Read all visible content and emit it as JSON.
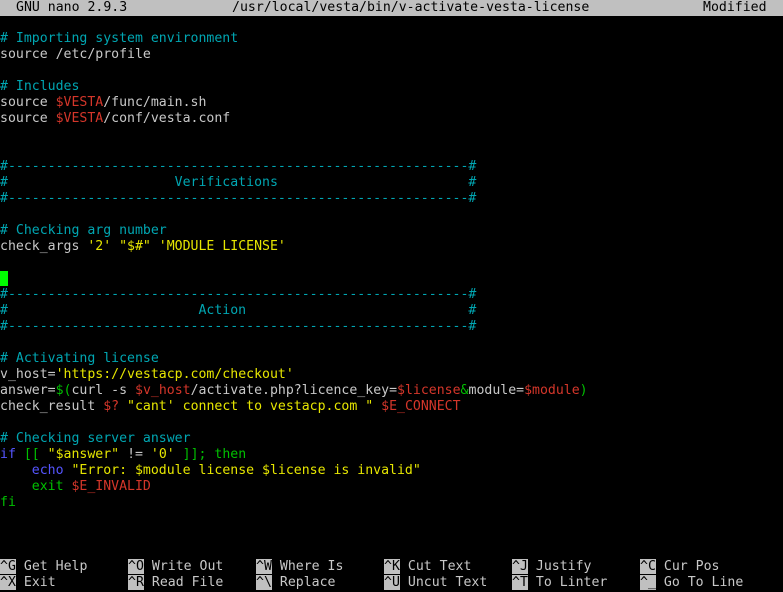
{
  "titlebar": {
    "app": "GNU nano 2.9.3",
    "file": "/usr/local/vesta/bin/v-activate-vesta-license",
    "status": "Modified"
  },
  "code_lines": [
    [
      {
        "t": "# Importing system environment",
        "c": "comment"
      }
    ],
    [
      {
        "t": "source /etc/profile",
        "c": "plain"
      }
    ],
    [],
    [
      {
        "t": "# Includes",
        "c": "comment"
      }
    ],
    [
      {
        "t": "source ",
        "c": "plain"
      },
      {
        "t": "$VESTA",
        "c": "var"
      },
      {
        "t": "/func/main.sh",
        "c": "plain"
      }
    ],
    [
      {
        "t": "source ",
        "c": "plain"
      },
      {
        "t": "$VESTA",
        "c": "var"
      },
      {
        "t": "/conf/vesta.conf",
        "c": "plain"
      }
    ],
    [],
    [],
    [
      {
        "t": "#----------------------------------------------------------#",
        "c": "comment"
      }
    ],
    [
      {
        "t": "#                     Verifications                        #",
        "c": "comment"
      }
    ],
    [
      {
        "t": "#----------------------------------------------------------#",
        "c": "comment"
      }
    ],
    [],
    [
      {
        "t": "# Checking arg number",
        "c": "comment"
      }
    ],
    [
      {
        "t": "check_args ",
        "c": "plain"
      },
      {
        "t": "'2' \"$#\" 'MODULE LICENSE'",
        "c": "str"
      }
    ],
    [],
    [
      {
        "t": "",
        "c": "cursor"
      }
    ],
    [
      {
        "t": "#----------------------------------------------------------#",
        "c": "comment"
      }
    ],
    [
      {
        "t": "#                        Action                            #",
        "c": "comment"
      }
    ],
    [
      {
        "t": "#----------------------------------------------------------#",
        "c": "comment"
      }
    ],
    [],
    [
      {
        "t": "# Activating license",
        "c": "comment"
      }
    ],
    [
      {
        "t": "v_host=",
        "c": "plain"
      },
      {
        "t": "'https://vestacp.com/checkout'",
        "c": "str"
      }
    ],
    [
      {
        "t": "answer=",
        "c": "plain"
      },
      {
        "t": "$(",
        "c": "green"
      },
      {
        "t": "curl -s ",
        "c": "plain"
      },
      {
        "t": "$v_host",
        "c": "var"
      },
      {
        "t": "/activate.php?licence_key=",
        "c": "plain"
      },
      {
        "t": "$license",
        "c": "var"
      },
      {
        "t": "&",
        "c": "green"
      },
      {
        "t": "module=",
        "c": "plain"
      },
      {
        "t": "$module",
        "c": "var"
      },
      {
        "t": ")",
        "c": "green"
      }
    ],
    [
      {
        "t": "check_result ",
        "c": "plain"
      },
      {
        "t": "$?",
        "c": "var"
      },
      {
        "t": " \"cant' connect to vestacp.com \" ",
        "c": "str"
      },
      {
        "t": "$E_CONNECT",
        "c": "var"
      }
    ],
    [],
    [
      {
        "t": "# Checking server answer",
        "c": "comment"
      }
    ],
    [
      {
        "t": "if",
        "c": "kw"
      },
      {
        "t": " [[ ",
        "c": "green"
      },
      {
        "t": "\"$answer\"",
        "c": "str"
      },
      {
        "t": " != ",
        "c": "plain"
      },
      {
        "t": "'0'",
        "c": "str"
      },
      {
        "t": " ]]; then",
        "c": "green"
      }
    ],
    [
      {
        "t": "    ",
        "c": "plain"
      },
      {
        "t": "echo",
        "c": "kw"
      },
      {
        "t": " \"Error: $module license $license is invalid\"",
        "c": "str"
      }
    ],
    [
      {
        "t": "    exit ",
        "c": "green"
      },
      {
        "t": "$E_INVALID",
        "c": "var"
      }
    ],
    [
      {
        "t": "fi",
        "c": "green"
      }
    ]
  ],
  "shortcuts": {
    "row1": [
      {
        "key": "^G",
        "label": "Get Help"
      },
      {
        "key": "^O",
        "label": "Write Out"
      },
      {
        "key": "^W",
        "label": "Where Is"
      },
      {
        "key": "^K",
        "label": "Cut Text"
      },
      {
        "key": "^J",
        "label": "Justify"
      },
      {
        "key": "^C",
        "label": "Cur Pos"
      }
    ],
    "row2": [
      {
        "key": "^X",
        "label": "Exit"
      },
      {
        "key": "^R",
        "label": "Read File"
      },
      {
        "key": "^\\",
        "label": "Replace"
      },
      {
        "key": "^U",
        "label": "Uncut Text"
      },
      {
        "key": "^T",
        "label": "To Linter"
      },
      {
        "key": "^_",
        "label": "Go To Line"
      }
    ]
  }
}
